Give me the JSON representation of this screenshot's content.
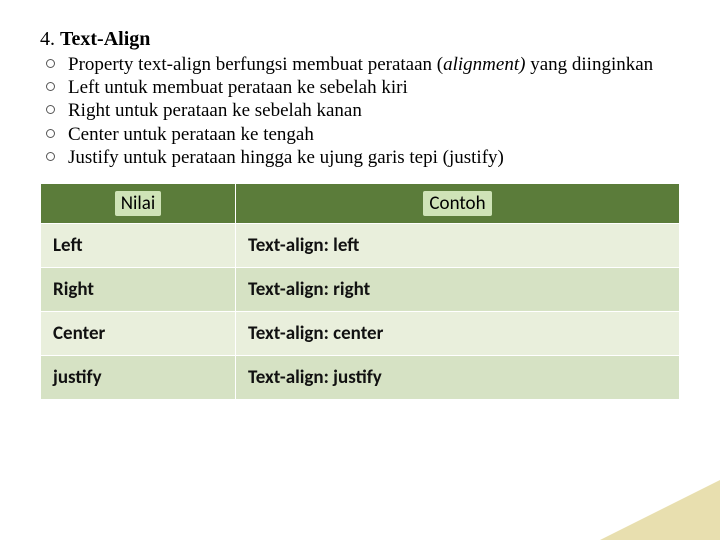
{
  "heading": {
    "num": "4.",
    "title": "Text-Align"
  },
  "bullets": [
    {
      "pre": "Property text-align berfungsi membuat perataan (",
      "it": "alignment)",
      "post": " yang diinginkan"
    },
    {
      "pre": "Left untuk membuat perataan ke sebelah kiri",
      "it": "",
      "post": ""
    },
    {
      "pre": "Right untuk perataan ke sebelah kanan",
      "it": "",
      "post": ""
    },
    {
      "pre": "Center untuk perataan ke tengah",
      "it": "",
      "post": ""
    },
    {
      "pre": "Justify untuk perataan hingga ke ujung garis tepi (justify)",
      "it": "",
      "post": ""
    }
  ],
  "table": {
    "headers": [
      "Nilai",
      "Contoh"
    ],
    "rows": [
      [
        "Left",
        "Text-align: left"
      ],
      [
        "Right",
        "Text-align: right"
      ],
      [
        "Center",
        "Text-align: center"
      ],
      [
        "justify",
        "Text-align: justify"
      ]
    ]
  }
}
